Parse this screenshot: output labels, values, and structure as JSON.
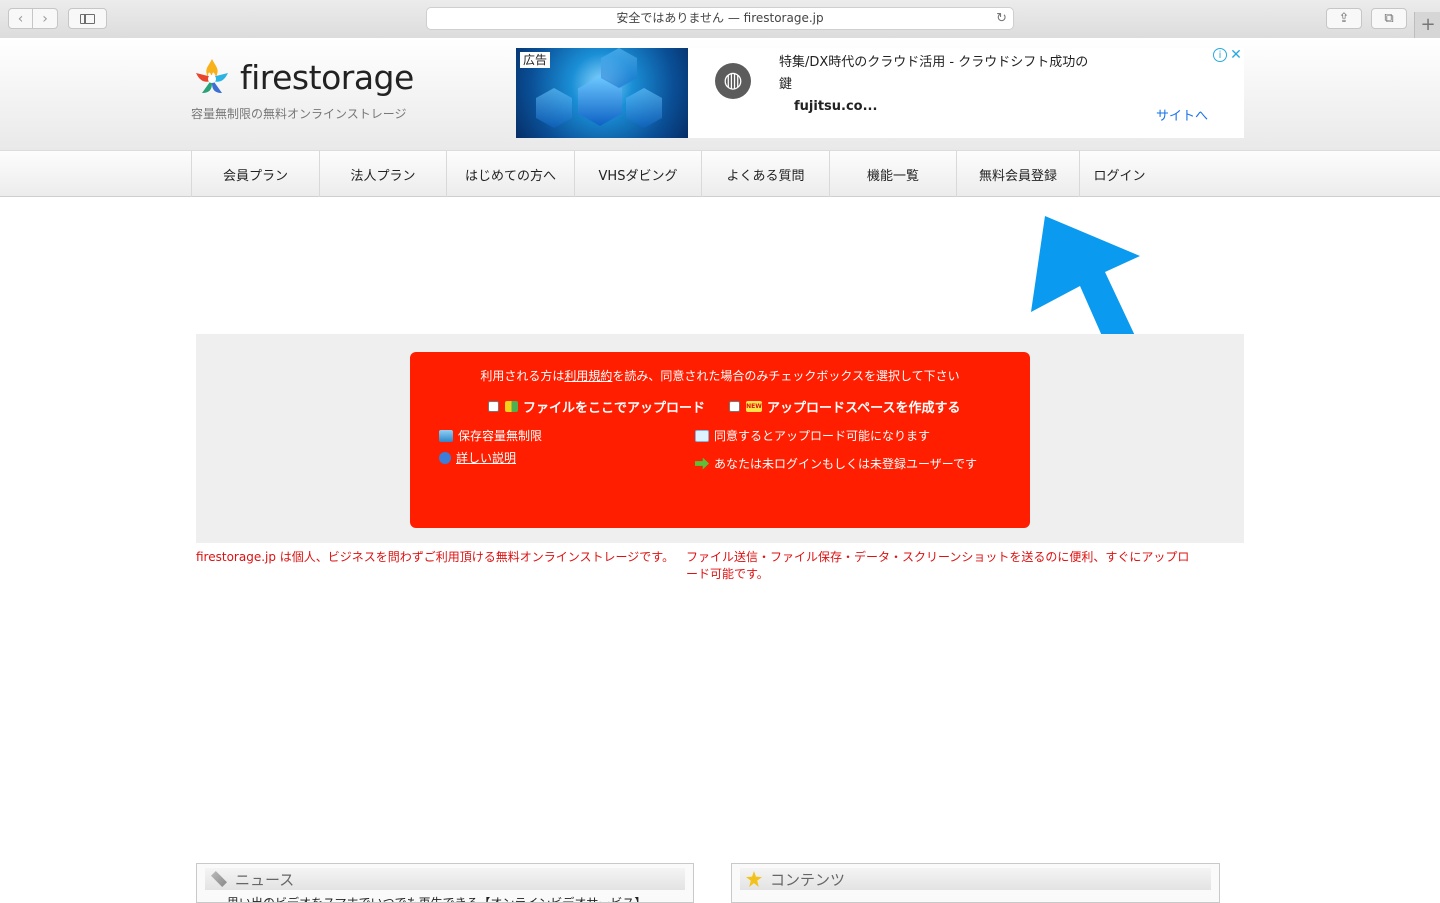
{
  "browser": {
    "address": "安全ではありません — firestorage.jp",
    "back_icon": "‹",
    "forward_icon": "›",
    "reload_icon": "↻",
    "share_icon": "⇪",
    "tabs_icon": "⧉",
    "newtab_icon": "+"
  },
  "header": {
    "logo_text": "firestorage",
    "tagline": "容量無制限の無料オンラインストレージ"
  },
  "ad": {
    "label": "広告",
    "title": "特集/DX時代のクラウド活用 - クラウドシフト成功の鍵",
    "domain": "fujitsu.co...",
    "cta": "サイトへ",
    "info_icon": "i",
    "close_icon": "✕"
  },
  "nav": {
    "items": [
      "会員プラン",
      "法人プラン",
      "はじめての方へ",
      "VHSダビング",
      "よくある質問",
      "機能一覧",
      "無料会員登録",
      "ログイン"
    ]
  },
  "upload": {
    "notice_pre": "利用される方は",
    "notice_link": "利用規約",
    "notice_post": "を読み、同意された場合のみチェックボックスを選択して下さい",
    "option1": "ファイルをここでアップロード",
    "option2": "アップロードスペースを作成する",
    "new_badge": "NEW",
    "feature_storage": "保存容量無制限",
    "feature_help": "詳しい説明",
    "feature_agree": "同意するとアップロード可能になります",
    "feature_login": "あなたは未ログインもしくは未登録ユーザーです"
  },
  "description": {
    "left": "firestorage.jp は個人、ビジネスを問わずご利用頂ける無料オンラインストレージです。",
    "right": "ファイル送信・ファイル保存・データ・スクリーンショットを送るのに便利、すぐにアップロード可能です。"
  },
  "panels": {
    "news_title": "ニュース",
    "news_row": "思い出のビデオをスマホでいつでも再生できる【オンラインビデオサービス】",
    "contents_title": "コンテンツ"
  },
  "colors": {
    "upload_red": "#ff1f00",
    "arrow_blue": "#0a9bf0",
    "desc_red": "#dd1111",
    "link_blue": "#1a73e8"
  }
}
